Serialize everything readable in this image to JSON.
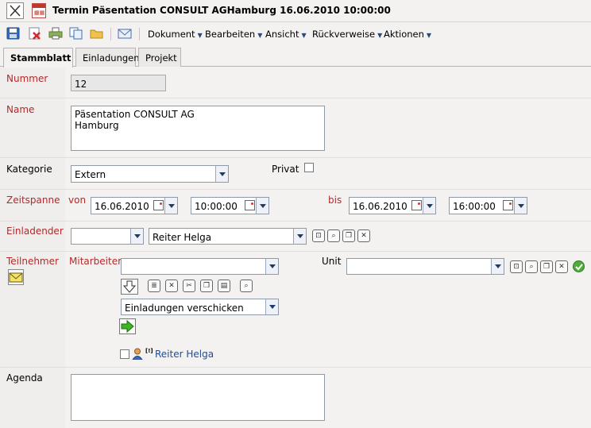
{
  "window": {
    "title": "Termin Päsentation CONSULT AGHamburg 16.06.2010 10:00:00"
  },
  "toolbar": {
    "menus": [
      "Dokument",
      "Bearbeiten",
      "Ansicht",
      "Rückverweise",
      "Aktionen"
    ]
  },
  "tabs": [
    "Stammblatt",
    "Einladungen",
    "Projekt"
  ],
  "active_tab": "Stammblatt",
  "form": {
    "nummer_label": "Nummer",
    "nummer_value": "12",
    "name_label": "Name",
    "name_lines": [
      "Päsentation CONSULT AG",
      "Hamburg"
    ],
    "kategorie_label": "Kategorie",
    "kategorie_value": "Extern",
    "privat_label": "Privat",
    "zeitspanne_label": "Zeitspanne",
    "von_label": "von",
    "bis_label": "bis",
    "von_date": "16.06.2010",
    "von_time": "10:00:00",
    "bis_date": "16.06.2010",
    "bis_time": "16:00:00",
    "einladender_label": "Einladender",
    "einladender_prefix": "",
    "einladender_value": "Reiter Helga",
    "teilnehmer_label": "Teilnehmer",
    "mitarbeiter_label": "Mitarbeiter",
    "mitarbeiter_value": "",
    "unit_label": "Unit",
    "unit_value": "",
    "einladung_action": "Einladungen verschicken",
    "participant_marker": "[!]",
    "participant_name": "Reiter Helga",
    "agenda_label": "Agenda"
  },
  "colors": {
    "required_label": "#b22a2a",
    "link": "#1a4fa0",
    "background": "#f4f1f1"
  }
}
